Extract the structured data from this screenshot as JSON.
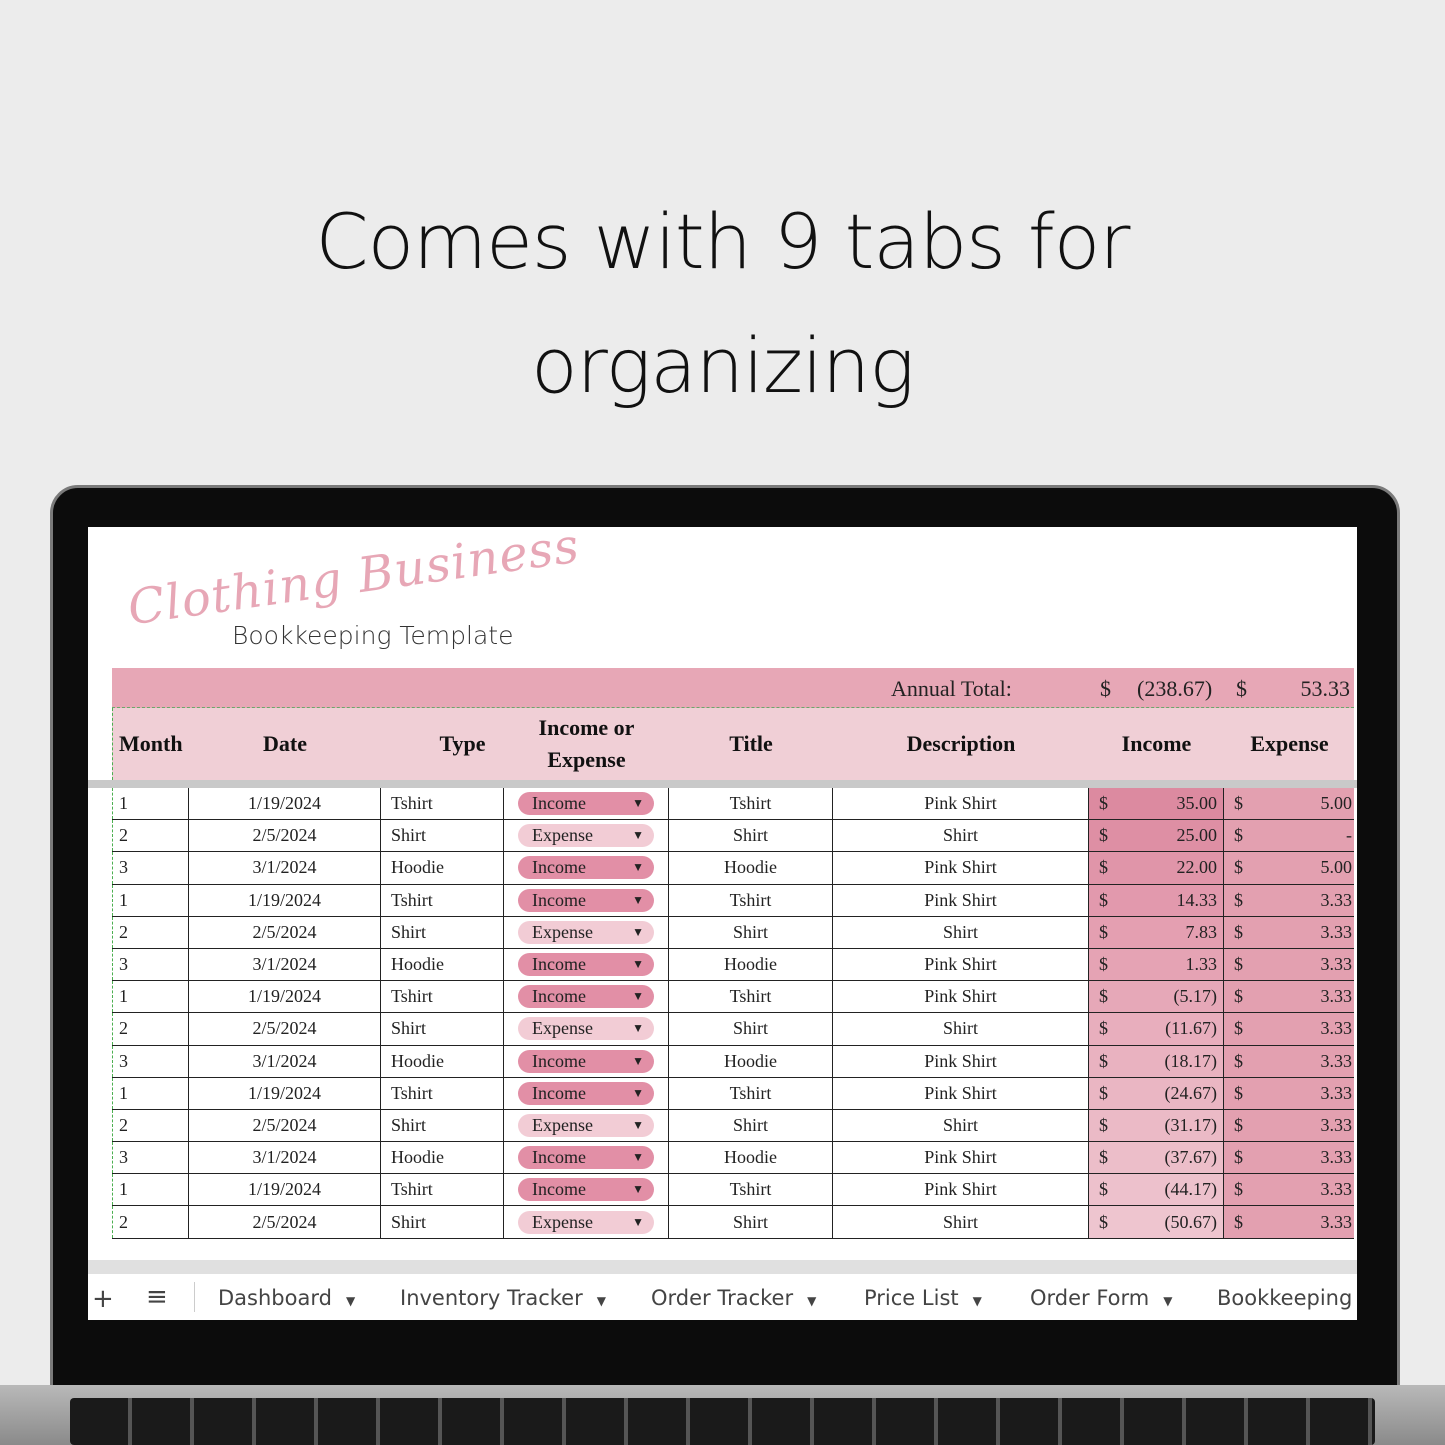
{
  "headline": [
    "Comes with 9 tabs for",
    "organizing"
  ],
  "logo": {
    "script": "Clothing Business",
    "subtitle": "Bookkeeping Template"
  },
  "totals": {
    "label": "Annual Total:",
    "currency": "$",
    "income": "(238.67)",
    "expense": "53.33"
  },
  "columns": [
    "Month",
    "Date",
    "Type",
    "Income or Expense",
    "Title",
    "Description",
    "Income",
    "Expense"
  ],
  "colors": {
    "income_pill": "#e28fa6",
    "expense_pill": "#f2ccd5",
    "header_bar": "#e7a7b6",
    "header_row": "#f0cfd6",
    "expense_col": "#e3a0b0"
  },
  "rows": [
    {
      "month": "1",
      "date": "1/19/2024",
      "type": "Tshirt",
      "ie": "Income",
      "title": "Tshirt",
      "desc": "Pink Shirt",
      "income": "35.00",
      "expense": "5.00"
    },
    {
      "month": "2",
      "date": "2/5/2024",
      "type": "Shirt",
      "ie": "Expense",
      "title": "Shirt",
      "desc": "Shirt",
      "income": "25.00",
      "expense": "-"
    },
    {
      "month": "3",
      "date": "3/1/2024",
      "type": "Hoodie",
      "ie": "Income",
      "title": "Hoodie",
      "desc": "Pink Shirt",
      "income": "22.00",
      "expense": "5.00"
    },
    {
      "month": "1",
      "date": "1/19/2024",
      "type": "Tshirt",
      "ie": "Income",
      "title": "Tshirt",
      "desc": "Pink Shirt",
      "income": "14.33",
      "expense": "3.33"
    },
    {
      "month": "2",
      "date": "2/5/2024",
      "type": "Shirt",
      "ie": "Expense",
      "title": "Shirt",
      "desc": "Shirt",
      "income": "7.83",
      "expense": "3.33"
    },
    {
      "month": "3",
      "date": "3/1/2024",
      "type": "Hoodie",
      "ie": "Income",
      "title": "Hoodie",
      "desc": "Pink Shirt",
      "income": "1.33",
      "expense": "3.33"
    },
    {
      "month": "1",
      "date": "1/19/2024",
      "type": "Tshirt",
      "ie": "Income",
      "title": "Tshirt",
      "desc": "Pink Shirt",
      "income": "(5.17)",
      "expense": "3.33"
    },
    {
      "month": "2",
      "date": "2/5/2024",
      "type": "Shirt",
      "ie": "Expense",
      "title": "Shirt",
      "desc": "Shirt",
      "income": "(11.67)",
      "expense": "3.33"
    },
    {
      "month": "3",
      "date": "3/1/2024",
      "type": "Hoodie",
      "ie": "Income",
      "title": "Hoodie",
      "desc": "Pink Shirt",
      "income": "(18.17)",
      "expense": "3.33"
    },
    {
      "month": "1",
      "date": "1/19/2024",
      "type": "Tshirt",
      "ie": "Income",
      "title": "Tshirt",
      "desc": "Pink Shirt",
      "income": "(24.67)",
      "expense": "3.33"
    },
    {
      "month": "2",
      "date": "2/5/2024",
      "type": "Shirt",
      "ie": "Expense",
      "title": "Shirt",
      "desc": "Shirt",
      "income": "(31.17)",
      "expense": "3.33"
    },
    {
      "month": "3",
      "date": "3/1/2024",
      "type": "Hoodie",
      "ie": "Income",
      "title": "Hoodie",
      "desc": "Pink Shirt",
      "income": "(37.67)",
      "expense": "3.33"
    },
    {
      "month": "1",
      "date": "1/19/2024",
      "type": "Tshirt",
      "ie": "Income",
      "title": "Tshirt",
      "desc": "Pink Shirt",
      "income": "(44.17)",
      "expense": "3.33"
    },
    {
      "month": "2",
      "date": "2/5/2024",
      "type": "Shirt",
      "ie": "Expense",
      "title": "Shirt",
      "desc": "Shirt",
      "income": "(50.67)",
      "expense": "3.33"
    }
  ],
  "sheet_tabs": {
    "add": "+",
    "menu": "≡",
    "tabs": [
      "Dashboard",
      "Inventory Tracker",
      "Order Tracker",
      "Price List",
      "Order Form",
      "Bookkeeping"
    ]
  }
}
